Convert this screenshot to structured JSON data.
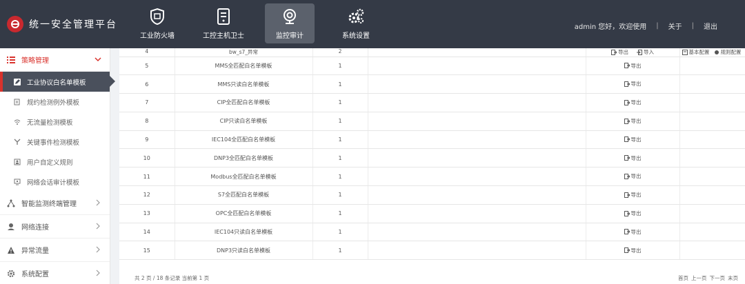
{
  "header": {
    "brand_title": "统一安全管理平台",
    "nav": [
      {
        "label": "工业防火墙",
        "icon": "shield-icon",
        "active": false
      },
      {
        "label": "工控主机卫士",
        "icon": "server-icon",
        "active": false
      },
      {
        "label": "监控审计",
        "icon": "camera-icon",
        "active": true
      },
      {
        "label": "系统设置",
        "icon": "gears-icon",
        "active": false
      }
    ],
    "greeting": "admin 您好，欢迎使用",
    "about": "关于",
    "logout": "退出"
  },
  "sidebar": {
    "groups": [
      {
        "label": "策略管理",
        "icon": "list-icon",
        "open": true,
        "items": [
          {
            "label": "工业协议白名单模板",
            "icon": "edit-icon",
            "active": true
          },
          {
            "label": "规约检测例外模板",
            "icon": "report-icon",
            "active": false
          },
          {
            "label": "无流量检测模板",
            "icon": "wifi-icon",
            "active": false
          },
          {
            "label": "关键事件检测模板",
            "icon": "split-icon",
            "active": false
          },
          {
            "label": "用户自定义规则",
            "icon": "user-rule-icon",
            "active": false
          },
          {
            "label": "网络会话审计模板",
            "icon": "monitor-icon",
            "active": false
          }
        ]
      },
      {
        "label": "智能监测终端管理",
        "icon": "network-icon",
        "open": false
      },
      {
        "label": "网络连接",
        "icon": "globe-icon",
        "open": false
      },
      {
        "label": "异常流量",
        "icon": "warning-icon",
        "open": false
      },
      {
        "label": "系统配置",
        "icon": "gear-icon",
        "open": false
      }
    ]
  },
  "table": {
    "rows": [
      {
        "no": "4",
        "name": "bw_s7_异常",
        "count": "2",
        "ops": [
          "导出",
          "导入"
        ],
        "extra": [
          "基本配置",
          "规则配置",
          "删除"
        ]
      },
      {
        "no": "5",
        "name": "MMS全匹配白名单模板",
        "count": "1",
        "ops": [
          "导出"
        ]
      },
      {
        "no": "6",
        "name": "MMS只读白名单模板",
        "count": "1",
        "ops": [
          "导出"
        ]
      },
      {
        "no": "7",
        "name": "CIP全匹配白名单模板",
        "count": "1",
        "ops": [
          "导出"
        ]
      },
      {
        "no": "8",
        "name": "CIP只读白名单模板",
        "count": "1",
        "ops": [
          "导出"
        ]
      },
      {
        "no": "9",
        "name": "IEC104全匹配白名单模板",
        "count": "1",
        "ops": [
          "导出"
        ]
      },
      {
        "no": "10",
        "name": "DNP3全匹配白名单模板",
        "count": "1",
        "ops": [
          "导出"
        ]
      },
      {
        "no": "11",
        "name": "Modbus全匹配白名单模板",
        "count": "1",
        "ops": [
          "导出"
        ]
      },
      {
        "no": "12",
        "name": "S7全匹配白名单模板",
        "count": "1",
        "ops": [
          "导出"
        ]
      },
      {
        "no": "13",
        "name": "OPC全匹配白名单模板",
        "count": "1",
        "ops": [
          "导出"
        ]
      },
      {
        "no": "14",
        "name": "IEC104只读白名单模板",
        "count": "1",
        "ops": [
          "导出"
        ]
      },
      {
        "no": "15",
        "name": "DNP3只读白名单模板",
        "count": "1",
        "ops": [
          "导出"
        ]
      }
    ]
  },
  "pagination": {
    "summary": "共 2 页 / 18 条记录 当前第 1 页",
    "first": "首页",
    "prev": "上一页",
    "next": "下一页",
    "last": "末页"
  },
  "colors": {
    "header_bg": "#343a46",
    "accent_red": "#d9322c",
    "active_nav": "#5b616c"
  }
}
